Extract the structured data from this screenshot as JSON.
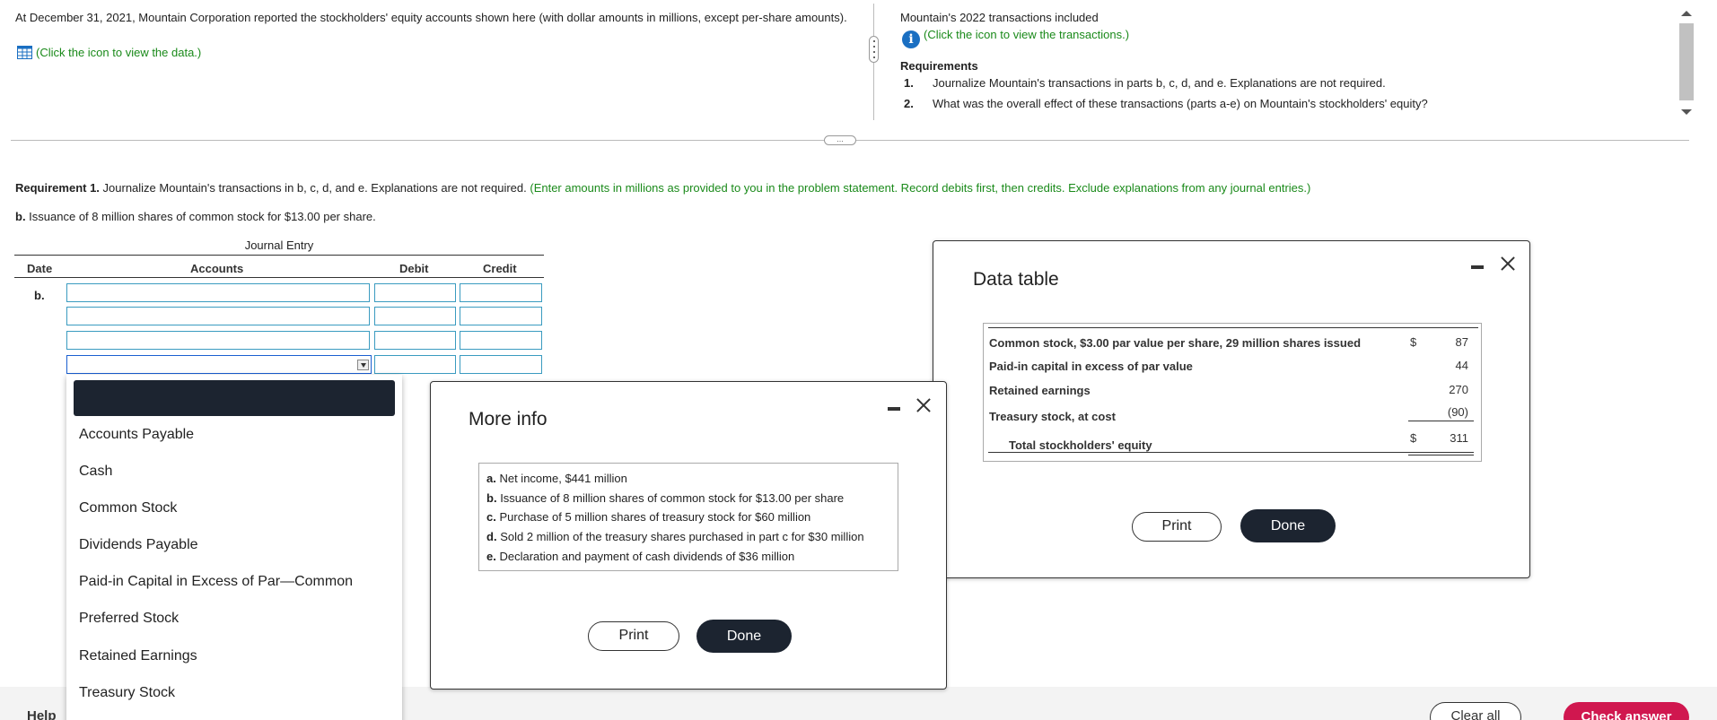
{
  "top_left": {
    "intro": "At December 31, 2021, Mountain Corporation reported the stockholders' equity accounts shown here (with dollar amounts in millions, except per-share amounts).",
    "data_link": "(Click the icon to view the data.)"
  },
  "top_right": {
    "transactions_intro": "Mountain's 2022 transactions included",
    "transactions_link": "(Click the icon to view the transactions.)",
    "requirements_heading": "Requirements",
    "requirements": [
      {
        "num": "1.",
        "text": "Journalize Mountain's transactions in parts b, c, d, and e. Explanations are not required."
      },
      {
        "num": "2.",
        "text": "What was the overall effect of these transactions (parts a-e) on Mountain's stockholders' equity?"
      }
    ]
  },
  "requirement1": {
    "label": "Requirement 1.",
    "text": " Journalize Mountain's transactions in b, c, d, and e. Explanations are not required. ",
    "instruction": "(Enter amounts in millions as provided to you in the problem statement. Record debits first, then credits. Exclude explanations from any journal entries.)",
    "part_label": "b.",
    "part_text": " Issuance of 8 million shares of common stock for $13.00 per share."
  },
  "journal": {
    "title": "Journal Entry",
    "col_date": "Date",
    "col_accounts": "Accounts",
    "col_debit": "Debit",
    "col_credit": "Credit",
    "row_date": "b."
  },
  "dropdown": {
    "options": [
      "Accounts Payable",
      "Cash",
      "Common Stock",
      "Dividends Payable",
      "Paid-in Capital in Excess of Par—Common",
      "Preferred Stock",
      "Retained Earnings",
      "Treasury Stock"
    ]
  },
  "more_info": {
    "title": "More info",
    "items": [
      {
        "letter": "a.",
        "text": "Net income, $441 million"
      },
      {
        "letter": "b.",
        "text": "Issuance of 8 million shares of common stock for $13.00 per share"
      },
      {
        "letter": "c.",
        "text": "Purchase of 5 million shares of treasury stock for $60 million"
      },
      {
        "letter": "d.",
        "text": "Sold 2 million of the treasury shares purchased in part c for $30 million"
      },
      {
        "letter": "e.",
        "text": "Declaration and payment of cash dividends of $36 million"
      }
    ],
    "print_label": "Print",
    "done_label": "Done"
  },
  "data_table": {
    "title": "Data table",
    "rows": [
      {
        "label": "Common stock, $3.00 par value per share, 29 million shares issued",
        "currency": "$",
        "value": "87"
      },
      {
        "label": "Paid-in capital in excess of par value",
        "currency": "",
        "value": "44"
      },
      {
        "label": "Retained earnings",
        "currency": "",
        "value": "270"
      },
      {
        "label": "Treasury stock, at cost",
        "currency": "",
        "value": "(90)"
      },
      {
        "label": "Total stockholders' equity",
        "currency": "$",
        "value": "311"
      }
    ],
    "print_label": "Print",
    "done_label": "Done"
  },
  "bottom": {
    "help": "Help",
    "clear_all": "Clear all",
    "check_answer": "Check answer"
  },
  "colors": {
    "accent_green": "#1a8a1a",
    "dark_button": "#1c2430",
    "check_answer": "#d0174f"
  }
}
